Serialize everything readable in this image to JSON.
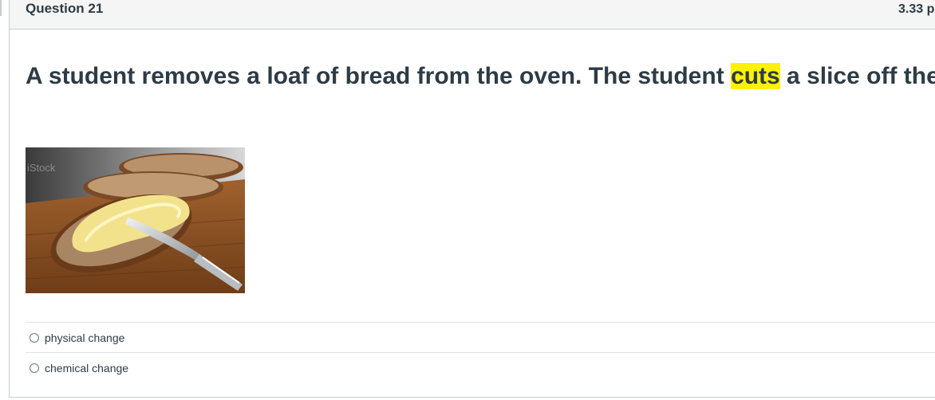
{
  "question": {
    "title": "Question 21",
    "points": "3.33 p",
    "prompt_before": "A student removes a loaf of bread from the oven. The student ",
    "prompt_highlight": "cuts",
    "prompt_after": " a slice off the loaf and spreads butter on it."
  },
  "image": {
    "watermark": "iStock"
  },
  "answers": [
    {
      "label": "physical change",
      "selected": false
    },
    {
      "label": "chemical change",
      "selected": false
    }
  ],
  "colors": {
    "highlight": "#fff200",
    "text": "#2d3b45",
    "header_bg": "#f5f5f5",
    "border": "#c7cdd1"
  }
}
